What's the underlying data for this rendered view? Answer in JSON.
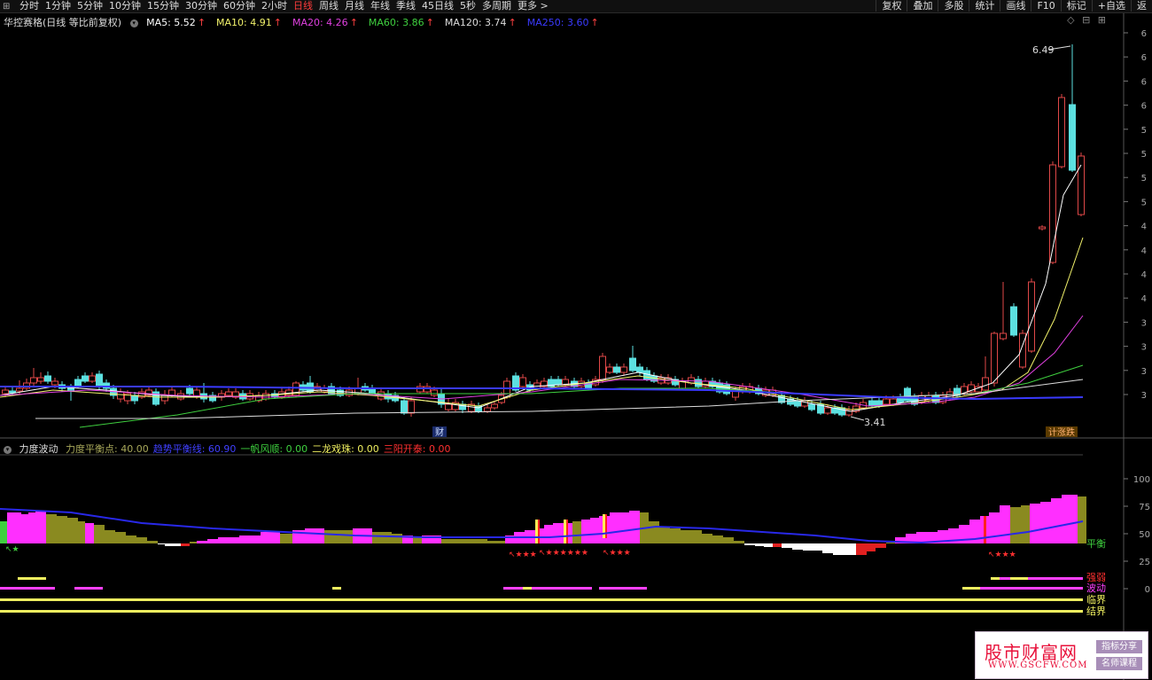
{
  "toolbar": {
    "periods": [
      "分时",
      "1分钟",
      "5分钟",
      "10分钟",
      "15分钟",
      "30分钟",
      "60分钟",
      "2小时",
      "日线",
      "周线",
      "月线",
      "年线",
      "季线",
      "45日线",
      "5秒",
      "多周期",
      "更多 >"
    ],
    "active_period": "日线",
    "right_buttons": [
      "复权",
      "叠加",
      "多股",
      "统计",
      "画线",
      "F10",
      "标记",
      "+自选",
      "返"
    ]
  },
  "window_buttons": [
    "◇",
    "⊟",
    "⊞"
  ],
  "main_chart": {
    "title": "华控赛格(日线 等比前复权)",
    "ma": [
      {
        "label": "MA5: 5.52",
        "color": "#ffffff"
      },
      {
        "label": "MA10: 4.91",
        "color": "#f2f26b"
      },
      {
        "label": "MA20: 4.26",
        "color": "#e040e0"
      },
      {
        "label": "MA60: 3.86",
        "color": "#3fcf3f"
      },
      {
        "label": "MA120: 3.74",
        "color": "#dddddd"
      },
      {
        "label": "MA250: 3.60",
        "color": "#3a3aff"
      }
    ],
    "arrow": "↑",
    "y_ticks": [
      "6",
      "6",
      "6",
      "6",
      "5",
      "5",
      "5",
      "5",
      "4",
      "4",
      "4",
      "4",
      "3",
      "3",
      "3",
      "3"
    ],
    "high_label": "6.49",
    "low_label": "3.41",
    "cai_label": "财",
    "event_label": "计涨跌"
  },
  "sub_chart": {
    "title": "力度波动",
    "params": [
      {
        "label": "力度平衡点: 40.00",
        "color": "#a8a85a"
      },
      {
        "label": "趋势平衡线: 60.90",
        "color": "#4040ff"
      },
      {
        "label": "一帆风顺: 0.00",
        "color": "#3fd13f"
      },
      {
        "label": "二龙戏珠: 0.00",
        "color": "#f0f060"
      },
      {
        "label": "三阳开泰: 0.00",
        "color": "#ff3030"
      }
    ],
    "y_ticks": [
      "100",
      "75",
      "50",
      "25",
      "0"
    ],
    "right_labels": [
      {
        "text": "平衡",
        "color": "#3fd13f"
      },
      {
        "text": "强弱",
        "color": "#ff3030"
      },
      {
        "text": "波动",
        "color": "#ff40ff"
      },
      {
        "text": "临界",
        "color": "#f0f060"
      },
      {
        "text": "结界",
        "color": "#f0f060"
      }
    ]
  },
  "watermark": {
    "main": "股市财富网",
    "url": "WWW.GSCFW.COM",
    "badge1": "指标分享",
    "badge2": "名师课程"
  }
}
